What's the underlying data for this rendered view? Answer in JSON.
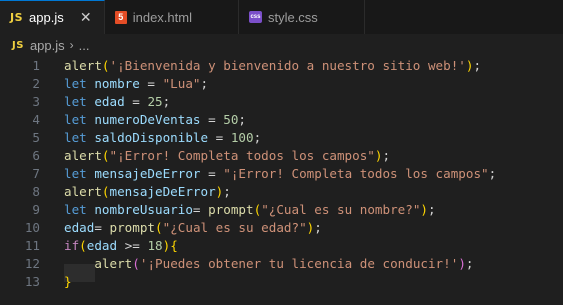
{
  "tabs": [
    {
      "icon": "js-icon",
      "icon_text": "JS",
      "label": "app.js",
      "active": true,
      "close": "✕"
    },
    {
      "icon": "html-icon",
      "icon_text": "5",
      "label": "index.html",
      "active": false
    },
    {
      "icon": "css-icon",
      "icon_text": "css",
      "label": "style.css",
      "active": false
    }
  ],
  "breadcrumb": {
    "icon_text": "JS",
    "file": "app.js",
    "separator": "›",
    "more": "..."
  },
  "lines": [
    {
      "n": "1",
      "tokens": [
        [
          "fn",
          "alert"
        ],
        [
          "br1",
          "("
        ],
        [
          "str",
          "'¡Bienvenida y bienvenido a nuestro sitio web!'"
        ],
        [
          "br1",
          ")"
        ],
        [
          "pun",
          ";"
        ]
      ]
    },
    {
      "n": "2",
      "tokens": [
        [
          "kw",
          "let"
        ],
        [
          "pun",
          " "
        ],
        [
          "var",
          "nombre"
        ],
        [
          "pun",
          " = "
        ],
        [
          "str",
          "\"Lua\""
        ],
        [
          "pun",
          ";"
        ]
      ]
    },
    {
      "n": "3",
      "tokens": [
        [
          "kw",
          "let"
        ],
        [
          "pun",
          " "
        ],
        [
          "var",
          "edad"
        ],
        [
          "pun",
          " = "
        ],
        [
          "num",
          "25"
        ],
        [
          "pun",
          ";"
        ]
      ]
    },
    {
      "n": "4",
      "tokens": [
        [
          "kw",
          "let"
        ],
        [
          "pun",
          " "
        ],
        [
          "var",
          "numeroDeVentas"
        ],
        [
          "pun",
          " = "
        ],
        [
          "num",
          "50"
        ],
        [
          "pun",
          ";"
        ]
      ]
    },
    {
      "n": "5",
      "tokens": [
        [
          "kw",
          "let"
        ],
        [
          "pun",
          " "
        ],
        [
          "var",
          "saldoDisponible"
        ],
        [
          "pun",
          " = "
        ],
        [
          "num",
          "100"
        ],
        [
          "pun",
          ";"
        ]
      ]
    },
    {
      "n": "6",
      "tokens": [
        [
          "fn",
          "alert"
        ],
        [
          "br1",
          "("
        ],
        [
          "str",
          "\"¡Error! Completa todos los campos\""
        ],
        [
          "br1",
          ")"
        ],
        [
          "pun",
          ";"
        ]
      ]
    },
    {
      "n": "7",
      "tokens": [
        [
          "kw",
          "let"
        ],
        [
          "pun",
          " "
        ],
        [
          "var",
          "mensajeDeError"
        ],
        [
          "pun",
          " = "
        ],
        [
          "str",
          "\"¡Error! Completa todos los campos\""
        ],
        [
          "pun",
          ";"
        ]
      ]
    },
    {
      "n": "8",
      "tokens": [
        [
          "fn",
          "alert"
        ],
        [
          "br1",
          "("
        ],
        [
          "var",
          "mensajeDeError"
        ],
        [
          "br1",
          ")"
        ],
        [
          "pun",
          ";"
        ]
      ]
    },
    {
      "n": "9",
      "tokens": [
        [
          "kw",
          "let"
        ],
        [
          "pun",
          " "
        ],
        [
          "var",
          "nombreUsuario"
        ],
        [
          "pun",
          "= "
        ],
        [
          "fn",
          "prompt"
        ],
        [
          "br1",
          "("
        ],
        [
          "str",
          "\"¿Cual es su nombre?\""
        ],
        [
          "br1",
          ")"
        ],
        [
          "pun",
          ";"
        ]
      ]
    },
    {
      "n": "10",
      "tokens": [
        [
          "var",
          "edad"
        ],
        [
          "pun",
          "= "
        ],
        [
          "fn",
          "prompt"
        ],
        [
          "br1",
          "("
        ],
        [
          "str",
          "\"¿Cual es su edad?\""
        ],
        [
          "br1",
          ")"
        ],
        [
          "pun",
          ";"
        ]
      ]
    },
    {
      "n": "11",
      "tokens": [
        [
          "ctl",
          "if"
        ],
        [
          "br1",
          "("
        ],
        [
          "var",
          "edad"
        ],
        [
          "pun",
          " >= "
        ],
        [
          "num",
          "18"
        ],
        [
          "br1",
          ")"
        ],
        [
          "br1",
          "{"
        ]
      ]
    },
    {
      "n": "12",
      "tokens": [
        [
          "pun",
          "    "
        ],
        [
          "fn",
          "alert"
        ],
        [
          "br2",
          "("
        ],
        [
          "str",
          "'¡Puedes obtener tu licencia de conducir!'"
        ],
        [
          "br2",
          ")"
        ],
        [
          "pun",
          ";"
        ]
      ]
    },
    {
      "n": "13",
      "tokens": [
        [
          "br1",
          "}"
        ]
      ]
    }
  ]
}
